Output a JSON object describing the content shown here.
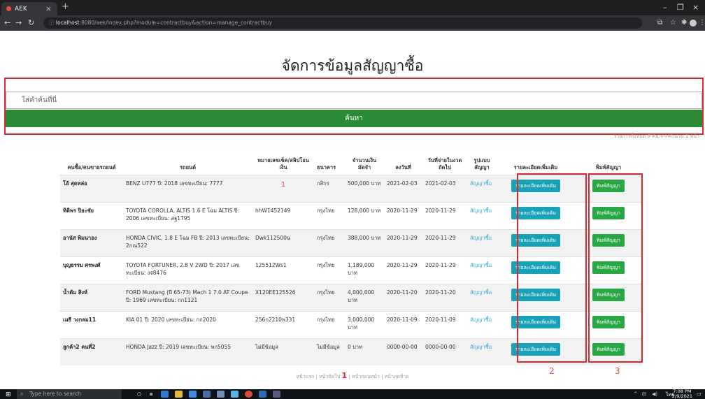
{
  "browser": {
    "tab_title": "AEK",
    "tab_close": "×",
    "new_tab": "+",
    "url_host": "localhost",
    "url_rest": ":8080/aek/index.php?module=contractbuy&action=manage_contractbuy",
    "win_minimize": "–",
    "win_restore": "❐",
    "win_close": "×"
  },
  "page": {
    "title": "จัดการข้อมูลสัญญาซื้อ",
    "search_placeholder": "ใส่คำค้นที่นี่",
    "search_button": "ค้นหา",
    "record_count": "รายการทั้งหมด 8 คัน จากจำนวน 1 หน้า"
  },
  "table": {
    "headers": {
      "buyer": "คนซื้อ/คนขายรถยนต์",
      "car": "รถยนต์",
      "check_no": "หมายเลขเช็ค/สลิปโอนเงิน",
      "bank": "ธนาคาร",
      "amount": "จำนวนเงินมัดจำ",
      "date": "ลงวันที่",
      "next_due": "วันที่จ่ายในงวดถัดไป",
      "contract_type": "รูปแบบสัญญา",
      "details": "รายละเอียดเพิ่มเติม",
      "print": "พิมพ์สัญญา"
    },
    "rows": [
      {
        "buyer": "โอ้ สุดหล่อ",
        "car": "BENZ U777 ปี: 2018 เลขทะเบียน: 7777",
        "check_no": "1",
        "bank": "กสิกร",
        "amount": "500,000 บาท",
        "date": "2021-02-03",
        "next_due": "2021-02-03",
        "contract_type": "สัญญาซื้อ",
        "details_btn": "รายละเอียดเพิ่มเติม",
        "print_btn": "พิมพ์สัญญา"
      },
      {
        "buyer": "ทิติพร ปิยะชัย",
        "car": "TOYOTA COROLLA, ALTIS 1.6 E โฉม ALTIS ปี: 2006 เลขทะเบียน: สฐ1795",
        "check_no": "hhW1452149",
        "bank": "กรุงไทย",
        "amount": "128,000 บาท",
        "date": "2020-11-29",
        "next_due": "2020-11-29",
        "contract_type": "สัญญาซื้อ",
        "details_btn": "รายละเอียดเพิ่มเติม",
        "print_btn": "พิมพ์สัญญา"
      },
      {
        "buyer": "อานัส พิมนาอง",
        "car": "HONDA CIVIC, 1.8 E โฉม FB ปี: 2013 เลขทะเบียน: 2กณ522",
        "check_no": "Dwk112500น",
        "bank": "กรุงไทย",
        "amount": "388,000 บาท",
        "date": "2020-11-29",
        "next_due": "2020-11-29",
        "contract_type": "สัญญาซื้อ",
        "details_btn": "รายละเอียดเพิ่มเติม",
        "print_btn": "พิมพ์สัญญา"
      },
      {
        "buyer": "บุญธรรม ศรพงศ์",
        "car": "TOYOTA FORTUNER, 2.8 V 2WD ปี: 2017 เลขทะเบียน: งจ8476",
        "check_no": "125512Ws1",
        "bank": "กรุงไทย",
        "amount": "1,189,000 บาท",
        "date": "2020-11-29",
        "next_due": "2020-11-29",
        "contract_type": "สัญญาซื้อ",
        "details_btn": "รายละเอียดเพิ่มเติม",
        "print_btn": "พิมพ์สัญญา"
      },
      {
        "buyer": "น้ำต้ม สิงห์",
        "car": "FORD Mustang (ปี 65-73) Mach 1 7.0 AT Coupe ปี: 1969 เลขทะเบียน: กก1121",
        "check_no": "X120EE125526",
        "bank": "กรุงไทย",
        "amount": "4,000,000 บาท",
        "date": "2020-11-20",
        "next_due": "2020-11-20",
        "contract_type": "สัญญาซื้อ",
        "details_btn": "รายละเอียดเพิ่มเติม",
        "print_btn": "พิมพ์สัญญา"
      },
      {
        "buyer": "เมธี วงกลม11",
        "car": "KIA 01 ปี: 2020 เลขทะเบียน: กก2020",
        "check_no": "256ก2210พ331",
        "bank": "กรุงไทย",
        "amount": "3,000,000 บาท",
        "date": "2020-11-09",
        "next_due": "2020-11-09",
        "contract_type": "สัญญาซื้อ",
        "details_btn": "รายละเอียดเพิ่มเติม",
        "print_btn": "พิมพ์สัญญา"
      },
      {
        "buyer": "ลูกค้า2 คนที่2",
        "car": "HONDA Jazz ปี: 2019 เลขทะเบียน: พก5055",
        "check_no": "ไม่มีข้อมูล",
        "bank": "ไม่มีข้อมูล",
        "amount": "0 บาท",
        "date": "0000-00-00",
        "next_due": "0000-00-00",
        "contract_type": "สัญญาซื้อ",
        "details_btn": "รายละเอียดเพิ่มเติม",
        "print_btn": "พิมพ์สัญญา"
      }
    ]
  },
  "annotations": {
    "box2": "2",
    "box3": "3"
  },
  "pagination": {
    "first": "หน้าแรก",
    "sep1": " | ",
    "next": "หน้าถัดไป",
    "current": "1",
    "sep2": " | ",
    "prev": "หน้าก่อนหน้า",
    "sep3": " | ",
    "last": "หน้าสุดท้าย"
  },
  "taskbar": {
    "search_placeholder": "Type here to search",
    "time": "7:08 PM",
    "date": "2/9/2021",
    "lang": "ไทย"
  },
  "colors": {
    "accent_green": "#2a8a35",
    "info_button": "#17a2b8",
    "success_button": "#28a745",
    "annotation_red": "#d9282f"
  }
}
